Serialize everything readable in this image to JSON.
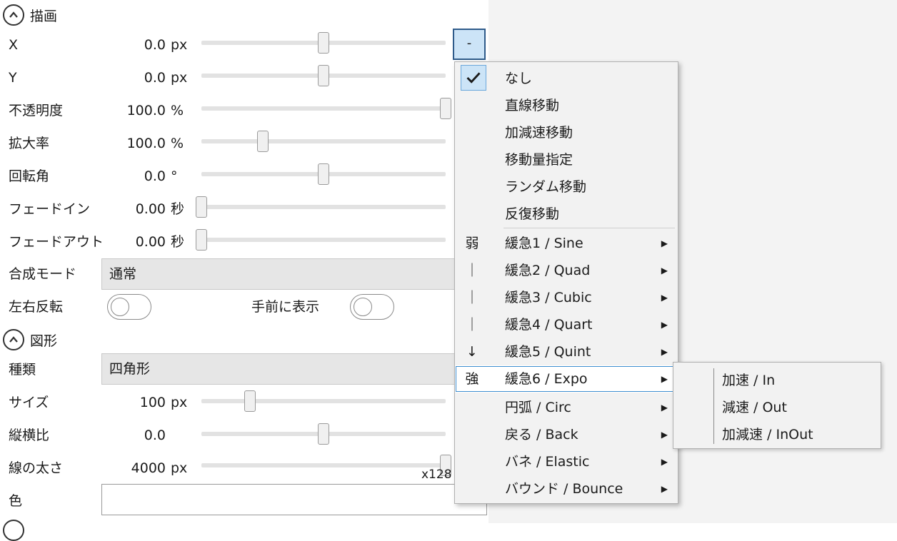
{
  "sections": {
    "draw": {
      "title": "描画"
    },
    "shape": {
      "title": "図形"
    }
  },
  "props": {
    "x": {
      "label": "X",
      "value": "0.0",
      "unit": "px",
      "level": 0.5
    },
    "y": {
      "label": "Y",
      "value": "0.0",
      "unit": "px",
      "level": 0.5
    },
    "opacity": {
      "label": "不透明度",
      "value": "100.0",
      "unit": "%",
      "level": 1.0
    },
    "scale": {
      "label": "拡大率",
      "value": "100.0",
      "unit": "%",
      "level": 0.25
    },
    "rotation": {
      "label": "回転角",
      "value": "0.0",
      "unit": "°",
      "level": 0.5
    },
    "fadein": {
      "label": "フェードイン",
      "value": "0.00",
      "unit": "秒",
      "level": 0.0
    },
    "fadeout": {
      "label": "フェードアウト",
      "value": "0.00",
      "unit": "秒",
      "level": 0.0
    },
    "blend": {
      "label": "合成モード",
      "selected": "通常"
    },
    "flip": {
      "label": "左右反転",
      "on": false
    },
    "front": {
      "label": "手前に表示",
      "on": false
    },
    "kind": {
      "label": "種類",
      "selected": "四角形"
    },
    "size": {
      "label": "サイズ",
      "value": "100",
      "unit": "px",
      "level": 0.2
    },
    "aspect": {
      "label": "縦横比",
      "value": "0.0",
      "level": 0.5
    },
    "linewidth": {
      "label": "線の太さ",
      "value": "4000",
      "unit": "px",
      "level": 1.0,
      "max_label": "x128"
    },
    "color": {
      "label": "色"
    }
  },
  "dropdown_button": {
    "label": "-"
  },
  "menu": {
    "items": [
      {
        "label": "なし",
        "checked": true
      },
      {
        "label": "直線移動"
      },
      {
        "label": "加減速移動"
      },
      {
        "label": "移動量指定"
      },
      {
        "label": "ランダム移動"
      },
      {
        "label": "反復移動"
      },
      {
        "label": "緩急1 / Sine",
        "side": "弱",
        "submenu": true
      },
      {
        "label": "緩急2 / Quad",
        "side": "｜",
        "submenu": true
      },
      {
        "label": "緩急3 / Cubic",
        "side": "｜",
        "submenu": true
      },
      {
        "label": "緩急4 / Quart",
        "side": "｜",
        "submenu": true
      },
      {
        "label": "緩急5 / Quint",
        "side": "↓",
        "submenu": true
      },
      {
        "label": "緩急6 / Expo",
        "side": "強",
        "submenu": true,
        "selected": true
      },
      {
        "label": "円弧 / Circ",
        "submenu": true
      },
      {
        "label": "戻る / Back",
        "submenu": true
      },
      {
        "label": "バネ / Elastic",
        "submenu": true
      },
      {
        "label": "バウンド / Bounce",
        "submenu": true
      }
    ]
  },
  "submenu": {
    "items": [
      {
        "label": "加速 / In"
      },
      {
        "label": "減速 / Out"
      },
      {
        "label": "加減速 / InOut"
      }
    ]
  },
  "icons": {
    "check": "checkmark-icon",
    "arrow": "chevron-right-icon",
    "section": "chevron-up-circle-icon"
  },
  "colors": {
    "accent": "#3c8dd0",
    "highlight": "#cce4f7",
    "menu_bg": "#f2f2f2"
  }
}
